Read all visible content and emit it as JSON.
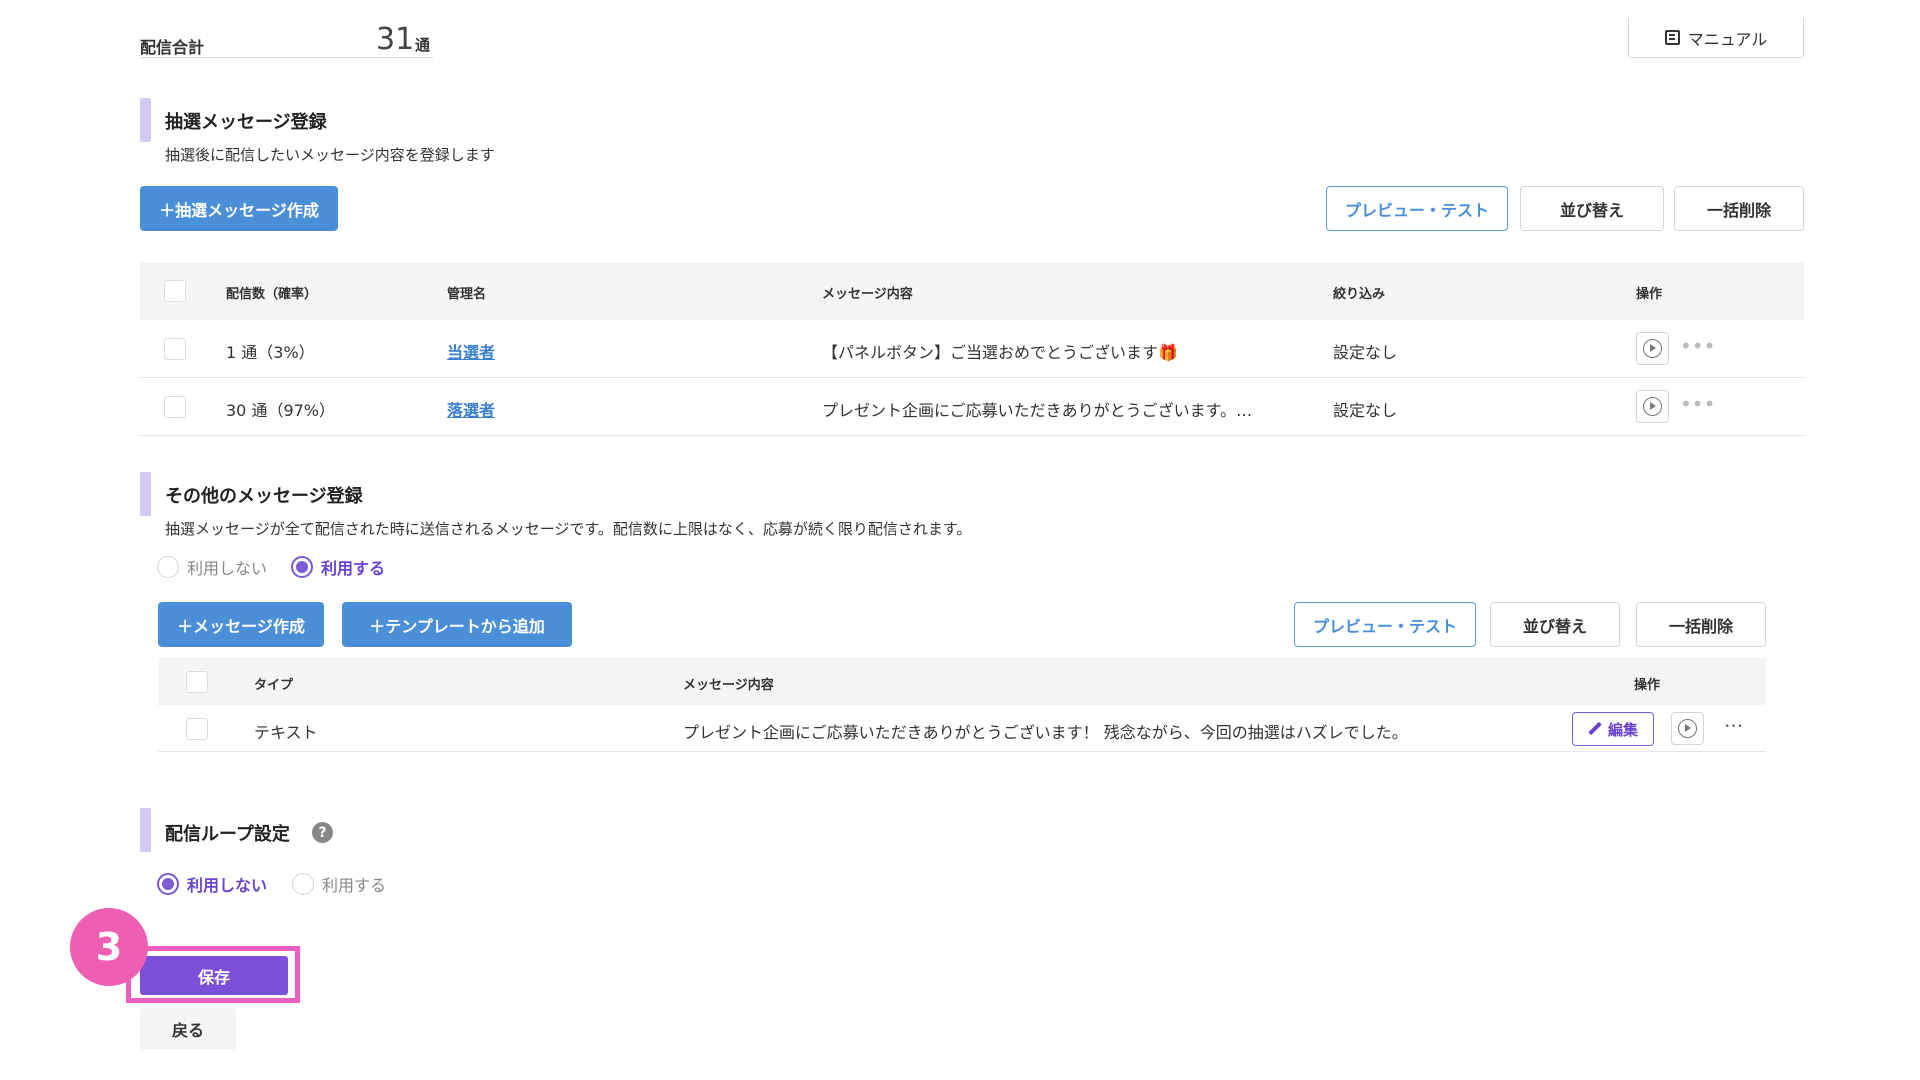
{
  "summary": {
    "label": "配信合計",
    "value": "31",
    "unit": "通",
    "manual_label": "マニュアル"
  },
  "lottery": {
    "title": "抽選メッセージ登録",
    "description": "抽選後に配信したいメッセージ内容を登録します",
    "create_label": "＋抽選メッセージ作成",
    "preview_label": "プレビュー・テスト",
    "sort_label": "並び替え",
    "bulk_delete_label": "一括削除",
    "columns": [
      "配信数（確率）",
      "管理名",
      "メッセージ内容",
      "絞り込み",
      "操作"
    ],
    "rows": [
      {
        "count": "1 通（3%）",
        "name": "当選者",
        "content": "【パネルボタン】ご当選おめでとうございます🎁",
        "filter": "設定なし"
      },
      {
        "count": "30 通（97%）",
        "name": "落選者",
        "content": "プレゼント企画にご応募いただきありがとうございます。…",
        "filter": "設定なし"
      }
    ]
  },
  "other": {
    "title": "その他のメッセージ登録",
    "description": "抽選メッセージが全て配信された時に送信されるメッセージです。配信数に上限はなく、応募が続く限り配信されます。",
    "radio_off": "利用しない",
    "radio_on": "利用する",
    "create_label": "＋メッセージ作成",
    "template_label": "＋テンプレートから追加",
    "preview_label": "プレビュー・テスト",
    "sort_label": "並び替え",
    "bulk_delete_label": "一括削除",
    "columns": [
      "タイプ",
      "メッセージ内容",
      "操作"
    ],
    "rows": [
      {
        "type": "テキスト",
        "content": "プレゼント企画にご応募いただきありがとうございます！ 残念ながら、今回の抽選はハズレでした。",
        "edit_label": "編集"
      }
    ]
  },
  "loop": {
    "title": "配信ループ設定",
    "help": "?",
    "radio_off": "利用しない",
    "radio_on": "利用する"
  },
  "footer": {
    "step": "3",
    "save_label": "保存",
    "back_label": "戻る"
  },
  "colors": {
    "accent_purple": "#7b4fd8",
    "primary_blue": "#4a8fd8",
    "highlight_pink": "#ea5fc0"
  }
}
